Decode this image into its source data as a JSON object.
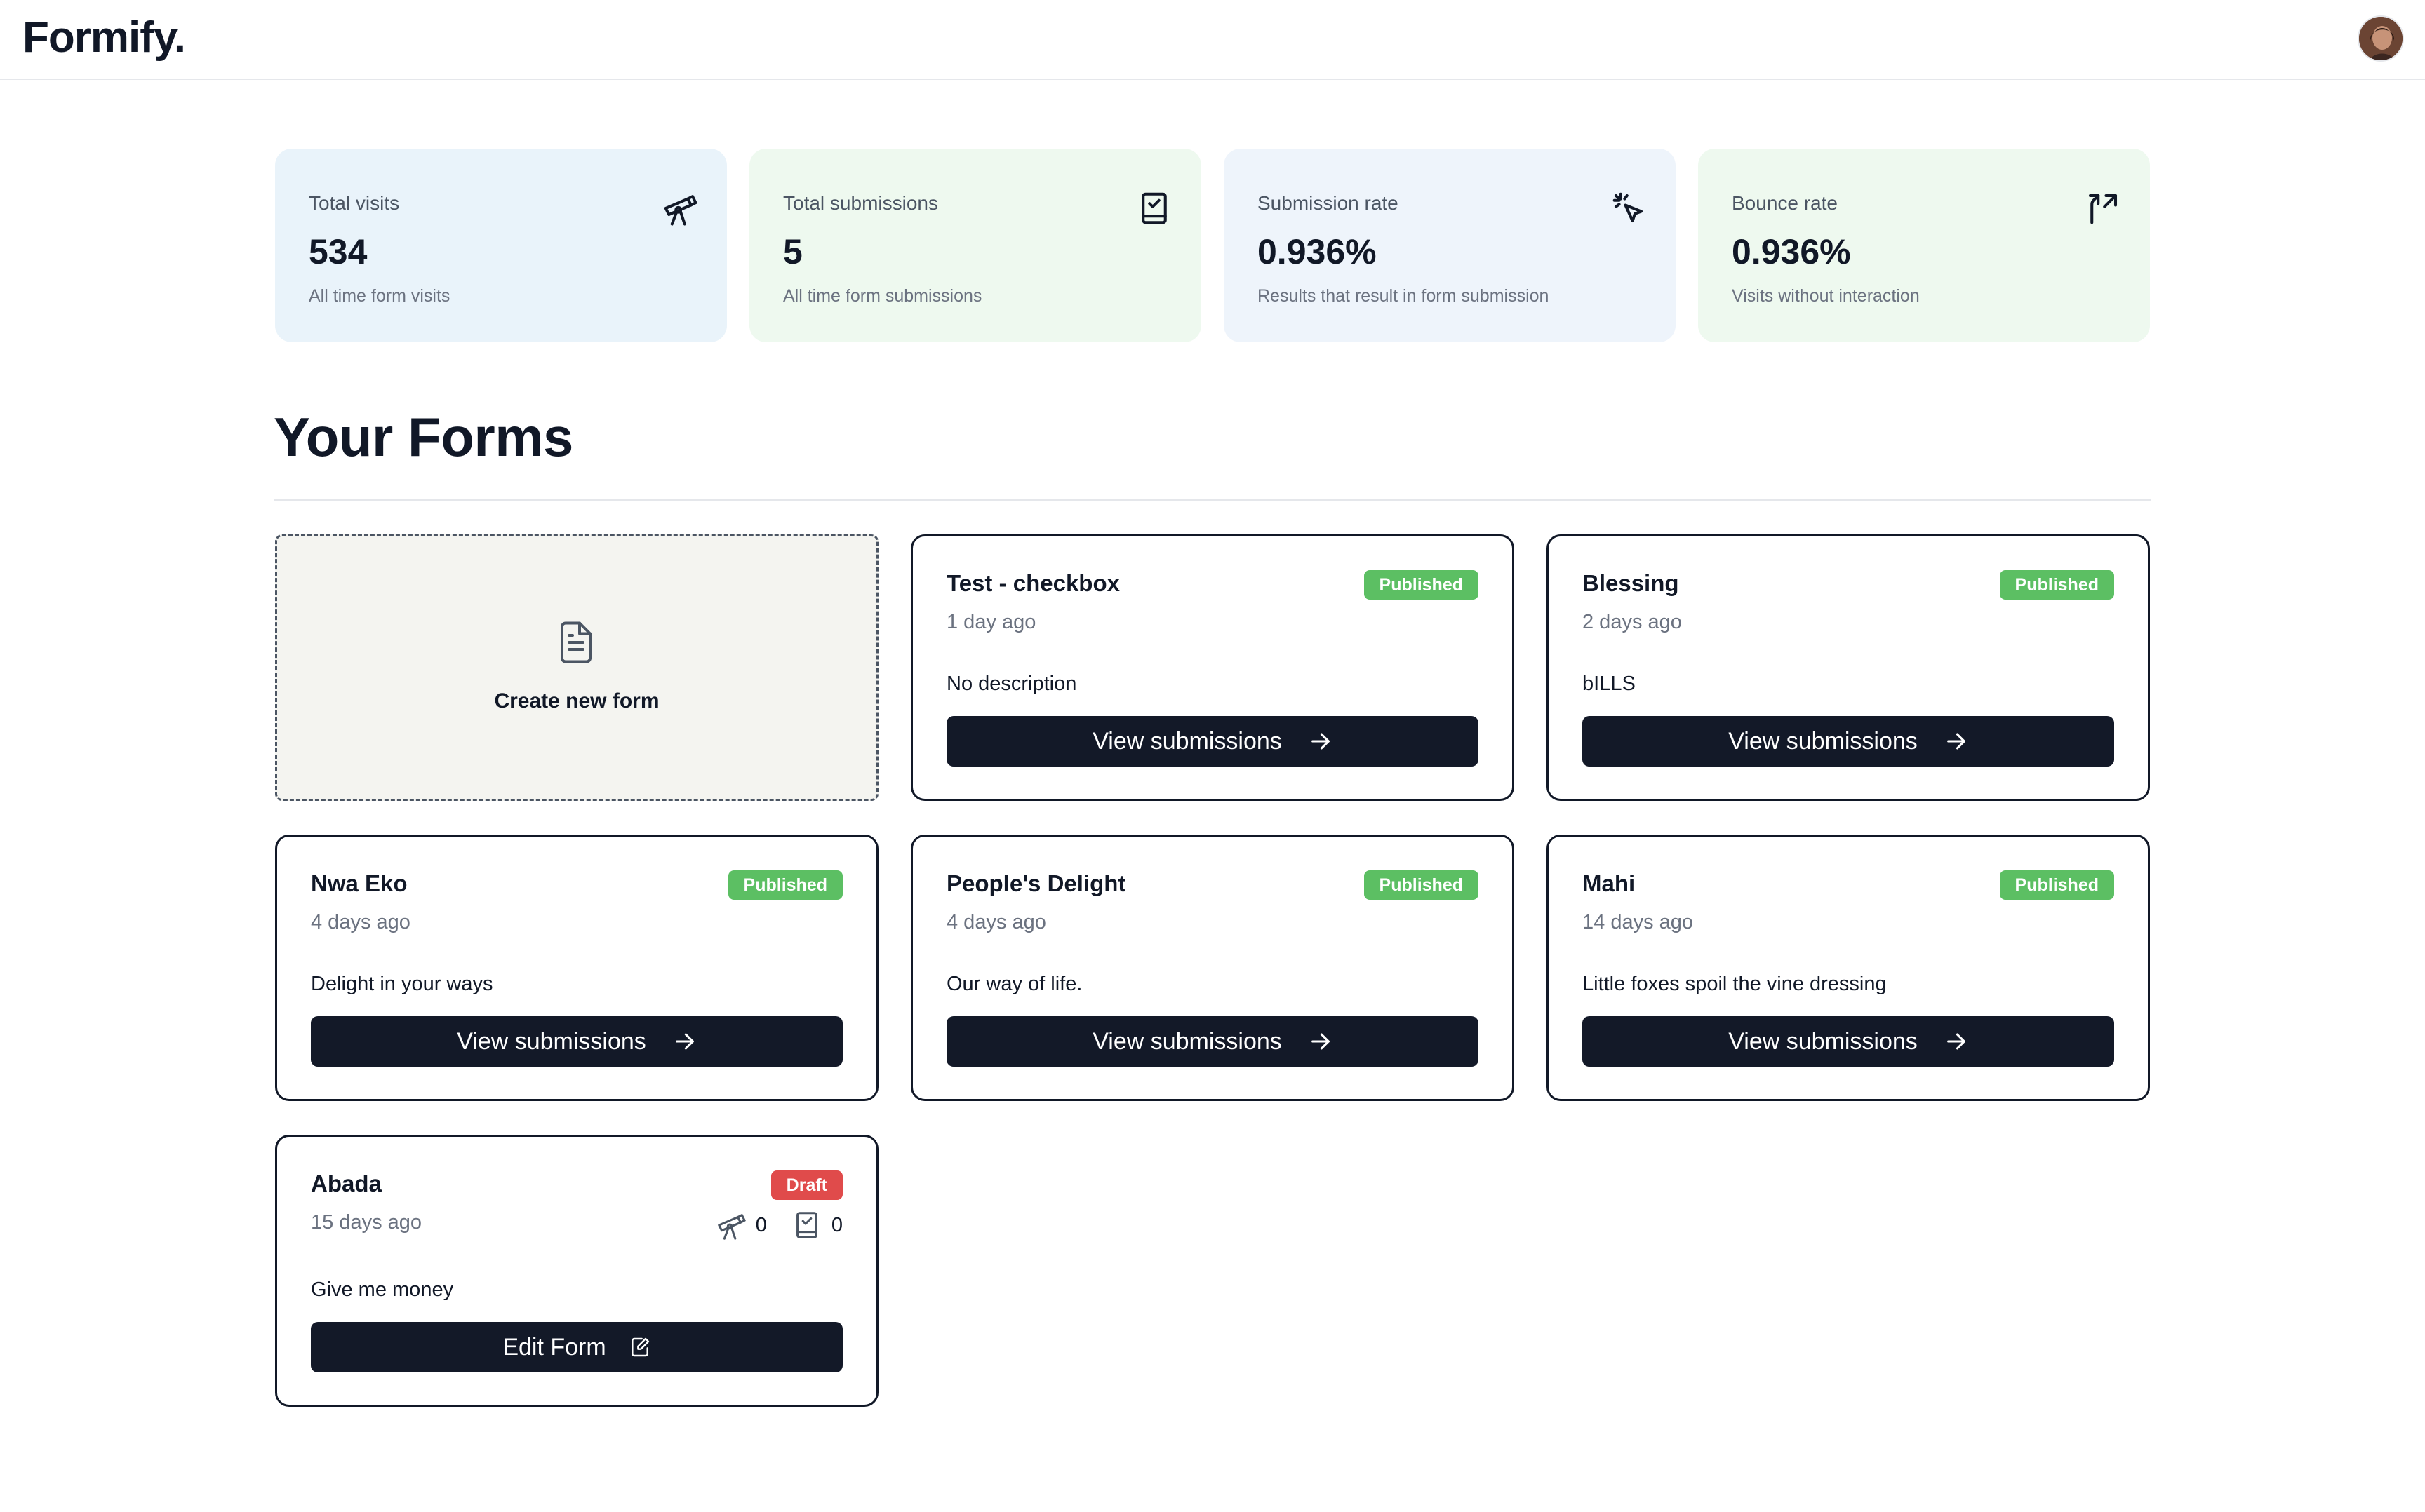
{
  "app": {
    "logo": "Formify."
  },
  "stats": [
    {
      "label": "Total visits",
      "value": "534",
      "help": "All time form visits",
      "icon": "telescope-icon"
    },
    {
      "label": "Total submissions",
      "value": "5",
      "help": "All time form submissions",
      "icon": "book-check-icon"
    },
    {
      "label": "Submission rate",
      "value": "0.936%",
      "help": "Results that result in form submission",
      "icon": "cursor-click-icon"
    },
    {
      "label": "Bounce rate",
      "value": "0.936%",
      "help": "Visits without interaction",
      "icon": "split-arrow-icon"
    }
  ],
  "forms_section": {
    "title": "Your Forms",
    "create_label": "Create new form"
  },
  "forms": [
    {
      "name": "Test - checkbox",
      "status": "Published",
      "time": "1 day ago",
      "description": "No description",
      "action": "View submissions"
    },
    {
      "name": "Blessing",
      "status": "Published",
      "time": "2 days ago",
      "description": "bILLS",
      "action": "View submissions"
    },
    {
      "name": "Nwa Eko",
      "status": "Published",
      "time": "4 days ago",
      "description": "Delight in your ways",
      "action": "View submissions"
    },
    {
      "name": "People's Delight",
      "status": "Published",
      "time": "4 days ago",
      "description": "Our way of life.",
      "action": "View submissions"
    },
    {
      "name": "Mahi",
      "status": "Published",
      "time": "14 days ago",
      "description": "Little foxes spoil the vine dressing",
      "action": "View submissions"
    },
    {
      "name": "Abada",
      "status": "Draft",
      "time": "15 days ago",
      "description": "Give me money",
      "action": "Edit Form",
      "visits": "0",
      "submissions": "0"
    }
  ],
  "colors": {
    "published": "#5cbf63",
    "draft": "#e04b4b",
    "button": "#131928",
    "visits_card": "#e9f3fa",
    "submissions_card": "#eef9ef"
  }
}
